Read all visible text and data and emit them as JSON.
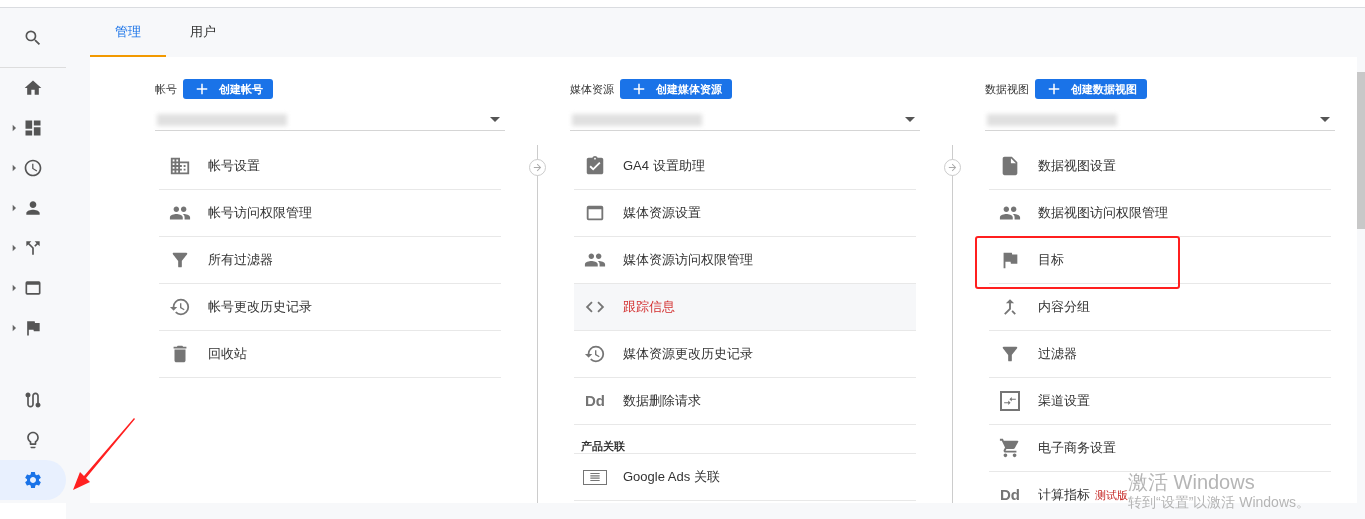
{
  "sidebar": {
    "top": [
      {
        "caret": false
      }
    ],
    "items": [
      {
        "caret": false
      },
      {
        "caret": true
      },
      {
        "caret": true
      },
      {
        "caret": true
      },
      {
        "caret": true
      },
      {
        "caret": true
      },
      {
        "caret": true
      }
    ],
    "bottom": [
      {
        "selected": false
      },
      {
        "selected": false
      },
      {
        "selected": true
      }
    ]
  },
  "tabs": [
    {
      "label": "管理",
      "selected": true
    },
    {
      "label": "用户",
      "selected": false
    }
  ],
  "columns": [
    {
      "label": "帐号",
      "create_button": "创建帐号",
      "items": [
        {
          "label": "帐号设置",
          "selected": false,
          "highlighted": false
        },
        {
          "label": "帐号访问权限管理",
          "selected": false,
          "highlighted": false
        },
        {
          "label": "所有过滤器",
          "selected": false,
          "highlighted": false
        },
        {
          "label": "帐号更改历史记录",
          "selected": false,
          "highlighted": false
        },
        {
          "label": "回收站",
          "selected": false,
          "highlighted": false
        }
      ]
    },
    {
      "label": "媒体资源",
      "create_button": "创建媒体资源",
      "items": [
        {
          "label": "GA4 设置助理",
          "selected": false,
          "highlighted": false
        },
        {
          "label": "媒体资源设置",
          "selected": false,
          "highlighted": false
        },
        {
          "label": "媒体资源访问权限管理",
          "selected": false,
          "highlighted": false
        },
        {
          "label": "跟踪信息",
          "selected": true,
          "highlighted": false
        },
        {
          "label": "媒体资源更改历史记录",
          "selected": false,
          "highlighted": false
        },
        {
          "icon_text": "Dd",
          "label": "数据删除请求",
          "selected": false,
          "highlighted": false
        }
      ],
      "section": {
        "title": "产品关联",
        "items": [
          {
            "label": "Google Ads 关联",
            "selected": false,
            "highlighted": false
          }
        ]
      }
    },
    {
      "label": "数据视图",
      "create_button": "创建数据视图",
      "items": [
        {
          "label": "数据视图设置",
          "selected": false,
          "highlighted": false
        },
        {
          "label": "数据视图访问权限管理",
          "selected": false,
          "highlighted": false
        },
        {
          "label": "目标",
          "selected": false,
          "highlighted": true
        },
        {
          "label": "内容分组",
          "selected": false,
          "highlighted": false
        },
        {
          "label": "过滤器",
          "selected": false,
          "highlighted": false
        },
        {
          "label": "渠道设置",
          "selected": false,
          "highlighted": false
        },
        {
          "label": "电子商务设置",
          "selected": false,
          "highlighted": false
        },
        {
          "icon_text": "Dd",
          "label": "计算指标",
          "badge": "测试版",
          "selected": false,
          "highlighted": false
        }
      ]
    }
  ],
  "annotation_arrow": true,
  "os_notice": {
    "title": "激活 Windows",
    "subtitle": "转到“设置”以激活 Windows。"
  }
}
